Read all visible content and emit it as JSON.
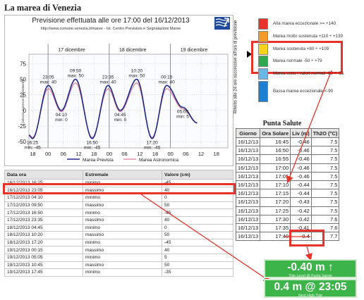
{
  "page_title": "La marea di Venezia",
  "chart": {
    "header": "Previsione effettuata alle ore 17:00 del 16/12/2013",
    "subheader": "http://www.comune.venezia.it/maree - Ist. Centro Previsioni e Segnalazioni Maree",
    "day_labels": [
      "17 dicembre",
      "18 dicembre",
      "19 dicembre"
    ],
    "y_ticks": [
      "75",
      "50",
      "25",
      "0",
      "-25",
      "-50"
    ],
    "x_ticks": [
      "18",
      "00",
      "06",
      "12",
      "18",
      "00",
      "06",
      "12",
      "18",
      "00",
      "06",
      "12",
      "18"
    ],
    "y_axis_label": "(altezze espresse in centimetri)",
    "legend_prevista": "Marea Prevista",
    "legend_astronomica": "Marea Astronomica",
    "labels": [
      {
        "time": "16:25",
        "type": "min",
        "value": "-45"
      },
      {
        "time": "23:05",
        "type": "max",
        "value": "40"
      },
      {
        "time": "04:10",
        "type": "min",
        "value": "0"
      },
      {
        "time": "09:50",
        "type": "max",
        "value": "50"
      },
      {
        "time": "16:50",
        "type": "min",
        "value": "-45"
      },
      {
        "time": "23:35",
        "type": "max",
        "value": "40"
      },
      {
        "time": "04:45",
        "type": "min",
        "value": "0"
      },
      {
        "time": "10:20",
        "type": "max",
        "value": "50"
      },
      {
        "time": "17:20",
        "type": "min",
        "value": "-45"
      },
      {
        "time": "00:15",
        "type": "max",
        "value": "40"
      },
      {
        "time": "05:05",
        "type": "min",
        "value": "5"
      },
      {
        "time": "10:45",
        "type": "max",
        "value": "50"
      }
    ]
  },
  "chart_data": {
    "type": "line",
    "title": "Previsione effettuata alle ore 17:00 del 16/12/2013",
    "ylabel": "(altezze espresse in centimetri)",
    "ylim": [
      -60,
      90
    ],
    "x_range_hours": [
      0,
      78
    ],
    "series": [
      {
        "name": "Marea Prevista",
        "color": "#1f2a8c",
        "x": [
          0,
          1.4,
          7.6,
          12.7,
          18.3,
          24.8,
          31.0,
          35.8,
          42.3,
          48.3,
          54.0,
          60.3
        ],
        "y": [
          -40,
          -45,
          40,
          0,
          50,
          -45,
          40,
          0,
          50,
          -45,
          40,
          5
        ]
      },
      {
        "name": "Marea Astronomica",
        "color": "#e07a96"
      }
    ],
    "extremes": [
      {
        "time": "16:25",
        "type": "min",
        "value": -45
      },
      {
        "time": "23:05",
        "type": "max",
        "value": 40
      },
      {
        "time": "04:10",
        "type": "min",
        "value": 0
      },
      {
        "time": "09:50",
        "type": "max",
        "value": 50
      },
      {
        "time": "16:50",
        "type": "min",
        "value": -45
      },
      {
        "time": "23:35",
        "type": "max",
        "value": 40
      },
      {
        "time": "04:45",
        "type": "min",
        "value": 0
      },
      {
        "time": "10:20",
        "type": "max",
        "value": 50
      },
      {
        "time": "17:20",
        "type": "min",
        "value": -45
      },
      {
        "time": "00:15",
        "type": "max",
        "value": 40
      },
      {
        "time": "05:05",
        "type": "min",
        "value": 5
      },
      {
        "time": "10:45",
        "type": "max",
        "value": 50
      }
    ],
    "grid": true
  },
  "legend": {
    "rotated_label": "Riferito alle 24 ore successive all'ora di previsione",
    "items": [
      {
        "label": "Alta marea eccezionale >= +140",
        "color": "#e8332a"
      },
      {
        "label": "Marea molto sostenuta +110 ÷ +139",
        "color": "#f39a2b"
      },
      {
        "label": "Marea sostenuta +80 ÷ +109",
        "color": "#f6d21c"
      },
      {
        "label": "Marea normale -50 ÷ +79",
        "color": "#2fa84f"
      },
      {
        "label": "Marea sotto i valori normali -90 ÷ -51",
        "color": "#6cb6e6"
      },
      {
        "label": "Bassa marea eccezionale <-90",
        "color": "#1f7fd1"
      }
    ]
  },
  "punta_salute": {
    "title": "Punta Salute",
    "headers": [
      "Giorno",
      "Ora Solare",
      "Liv (m)",
      "Th2O (°C)"
    ],
    "rows": [
      [
        "16/12/13",
        "16:45",
        "-0.46",
        "7.5"
      ],
      [
        "16/12/13",
        "16:50",
        "-0.46",
        "7.5"
      ],
      [
        "16/12/13",
        "16:55",
        "-0.46",
        "7.5"
      ],
      [
        "16/12/13",
        "17:00",
        "-0.46",
        "7.5"
      ],
      [
        "16/12/13",
        "17:05",
        "-0.46",
        "7.5"
      ],
      [
        "16/12/13",
        "17:10",
        "-0.44",
        "7.5"
      ],
      [
        "16/12/13",
        "17:15",
        "-0.44",
        "7.5"
      ],
      [
        "16/12/13",
        "17:20",
        "-0.43",
        "7.5"
      ],
      [
        "16/12/13",
        "17:25",
        "-0.42",
        "7.5"
      ],
      [
        "16/12/13",
        "17:30",
        "-0.42",
        "7.6"
      ],
      [
        "16/12/13",
        "17:35",
        "-0.41",
        "7.6"
      ],
      [
        "16/12/13",
        "17:40",
        "-0.4",
        "7.7"
      ]
    ]
  },
  "data_table": {
    "headers": [
      "Data ora",
      "Estremale",
      "Valore (cm)"
    ],
    "rows": [
      [
        "16/12/2013 16:25",
        "minimo",
        "-45"
      ],
      [
        "16/12/2013 23:05",
        "massimo",
        "40"
      ],
      [
        "17/12/2013 04:10",
        "minimo",
        "0"
      ],
      [
        "17/12/2013 09:50",
        "massimo",
        "50"
      ],
      [
        "17/12/2013 16:50",
        "minimo",
        "-45"
      ],
      [
        "17/12/2013 23:35",
        "massimo",
        "40"
      ],
      [
        "18/12/2013 04:45",
        "minimo",
        "0"
      ],
      [
        "18/12/2013 10:20",
        "massimo",
        "50"
      ],
      [
        "18/12/2013 17:20",
        "minimo",
        "-45"
      ],
      [
        "19/12/2013 00:15",
        "massimo",
        "40"
      ],
      [
        "19/12/2013 05:05",
        "minimo",
        "5"
      ],
      [
        "19/12/2013 10:45",
        "massimo",
        "50"
      ],
      [
        "19/12/2013 17:45",
        "minimo",
        "-35"
      ]
    ]
  },
  "green_boxes": {
    "current_level": "-0.40 m ↑",
    "current_caption": "Tide Level @ Punta Salute",
    "next_tide": "0.4 m @ 23:05",
    "next_caption": "Next High Tide"
  }
}
